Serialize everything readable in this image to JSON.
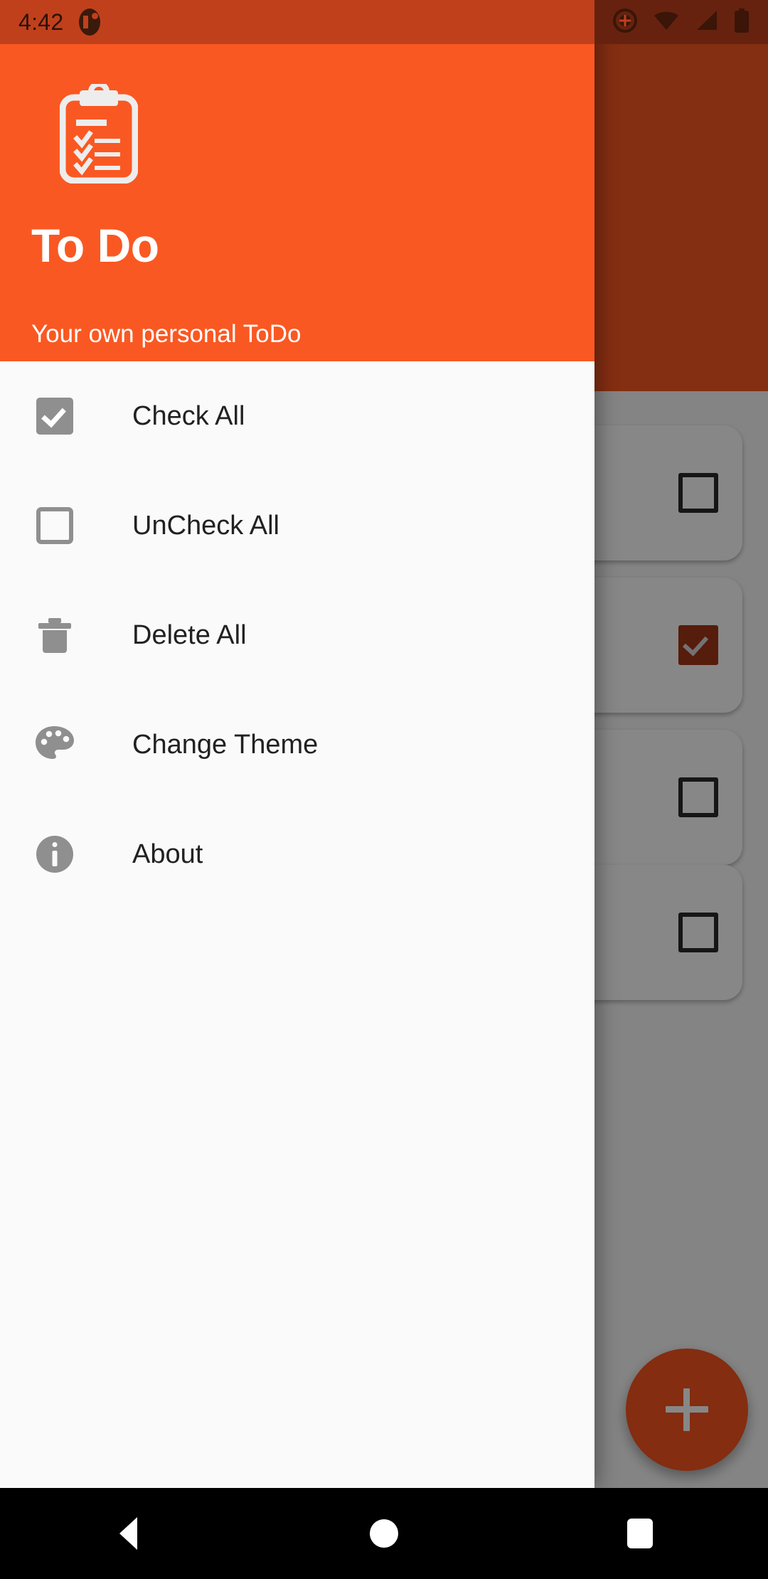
{
  "status_bar": {
    "time": "4:42",
    "app_icon": "todo-app-icon",
    "icons": [
      "location-target-icon",
      "wifi-icon",
      "signal-icon",
      "battery-icon"
    ],
    "background": "#C0401C"
  },
  "drawer": {
    "header": {
      "logo_icon": "clipboard-checklist-icon",
      "title": "To Do",
      "subtitle": "Your own personal ToDo",
      "background": "#FA5822",
      "text_color": "#FFFFFF"
    },
    "background": "#FAFAFA",
    "items": [
      {
        "label": "Check All",
        "icon": "checkbox-checked-icon",
        "name": "check-all"
      },
      {
        "label": "UnCheck All",
        "icon": "checkbox-unchecked-icon",
        "name": "uncheck-all"
      },
      {
        "label": "Delete All",
        "icon": "trash-icon",
        "name": "delete-all"
      },
      {
        "label": "Change Theme",
        "icon": "palette-icon",
        "name": "change-theme"
      },
      {
        "label": "About",
        "icon": "info-circle-icon",
        "name": "about"
      }
    ]
  },
  "app_background": {
    "appbar_color": "#FA5822",
    "content_color": "#FAFAFA",
    "tasks": [
      {
        "checked": false
      },
      {
        "checked": true
      },
      {
        "checked": false
      },
      {
        "checked": false
      }
    ],
    "fab": {
      "icon": "plus-icon",
      "color": "#F9561F"
    }
  },
  "navigation_bar": {
    "buttons": [
      {
        "name": "back",
        "icon": "triangle-back-icon"
      },
      {
        "name": "home",
        "icon": "circle-home-icon"
      },
      {
        "name": "recents",
        "icon": "square-recents-icon"
      }
    ],
    "background": "#000000"
  }
}
